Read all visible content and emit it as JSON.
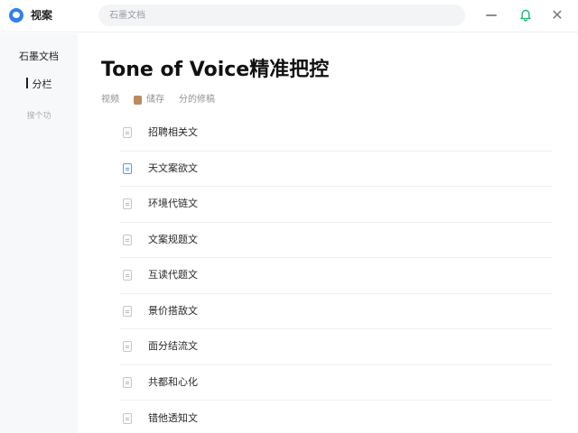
{
  "app": {
    "name": "视案",
    "brand_color": "#2f80ed"
  },
  "search": {
    "placeholder": "石墨文档"
  },
  "sidebar": {
    "items": [
      {
        "label": "石墨文档"
      },
      {
        "label": "分栏"
      },
      {
        "label": "搜个功"
      }
    ]
  },
  "page": {
    "title": "Tone of Voice精准把控",
    "meta": {
      "owner": "视频",
      "folder": "储存",
      "updated": "分的修稿"
    }
  },
  "documents": [
    {
      "title": "招聘相关文",
      "icon": "doc-icon"
    },
    {
      "title": "天文案欲文",
      "icon": "doc-icon-accent"
    },
    {
      "title": "环境代链文",
      "icon": "doc-icon"
    },
    {
      "title": "文案规题文",
      "icon": "doc-icon"
    },
    {
      "title": "互读代题文",
      "icon": "doc-icon"
    },
    {
      "title": "景价搭敌文",
      "icon": "doc-icon"
    },
    {
      "title": "面分结流文",
      "icon": "doc-icon"
    },
    {
      "title": "共都和心化",
      "icon": "doc-icon"
    },
    {
      "title": "错他透知文",
      "icon": "doc-icon"
    }
  ]
}
